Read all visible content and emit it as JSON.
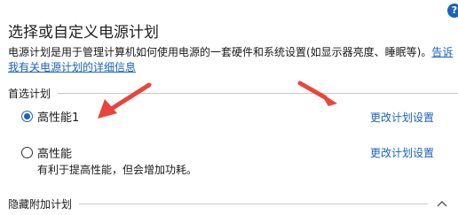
{
  "page": {
    "title": "选择或自定义电源计划",
    "help_icon": "?",
    "description_text": "电源计划是用于管理计算机如何使用电源的一套硬件和系统设置(如显示器亮度、睡眠等)。",
    "description_link": "告诉我有关电源计划的详细信息"
  },
  "preferred_section": {
    "label": "首选计划",
    "plans": [
      {
        "name": "高性能1",
        "selected": true,
        "change_label": "更改计划设置"
      },
      {
        "name": "高性能",
        "selected": false,
        "change_label": "更改计划设置",
        "desc": "有利于提高性能，但会增加功耗。"
      }
    ]
  },
  "hidden_section": {
    "label": "隐藏附加计划",
    "chevron_icon": "chevron-up-icon"
  },
  "colors": {
    "link": "#1a63b8",
    "annotation_arrow": "#e8453c"
  },
  "icons": [
    "help-icon",
    "radio-checked",
    "radio-unchecked",
    "chevron-up-icon"
  ]
}
